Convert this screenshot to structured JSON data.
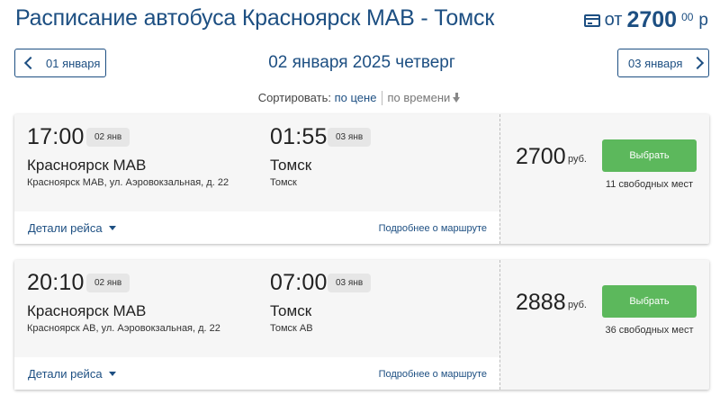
{
  "header": {
    "title": "Расписание автобуса Красноярск МАВ - Томск",
    "price_from_label": "от",
    "price_from_value": "2700",
    "price_from_cents": "00",
    "price_from_currency": "р",
    "icon": "credit-card-icon"
  },
  "date_nav": {
    "prev_label": "01 января",
    "current_label": "02 января 2025 четверг",
    "next_label": "03 января"
  },
  "sort": {
    "label": "Сортировать:",
    "by_price": "по цене",
    "by_time": "по времени"
  },
  "colors": {
    "accent": "#1d4f82",
    "button_green": "#5cb85c",
    "card_bg": "#f6f6f6"
  },
  "trips": [
    {
      "departure_time": "17:00",
      "departure_date": "02 янв",
      "departure_city": "Красноярск МАВ",
      "departure_address": "Красноярск МАВ, ул. Аэровокзальная, д. 22",
      "arrival_time": "01:55",
      "arrival_date": "03 янв",
      "arrival_city": "Томск",
      "arrival_address": "Томск",
      "price": "2700",
      "currency": "руб.",
      "select_label": "Выбрать",
      "seats": "11 свободных мест",
      "details_label": "Детали рейса",
      "route_label": "Подробнее о маршруте"
    },
    {
      "departure_time": "20:10",
      "departure_date": "02 янв",
      "departure_city": "Красноярск МАВ",
      "departure_address": "Красноярск АВ, ул. Аэровокзальная, д. 22",
      "arrival_time": "07:00",
      "arrival_date": "03 янв",
      "arrival_city": "Томск",
      "arrival_address": "Томск АВ",
      "price": "2888",
      "currency": "руб.",
      "select_label": "Выбрать",
      "seats": "36 свободных мест",
      "details_label": "Детали рейса",
      "route_label": "Подробнее о маршруте"
    }
  ]
}
